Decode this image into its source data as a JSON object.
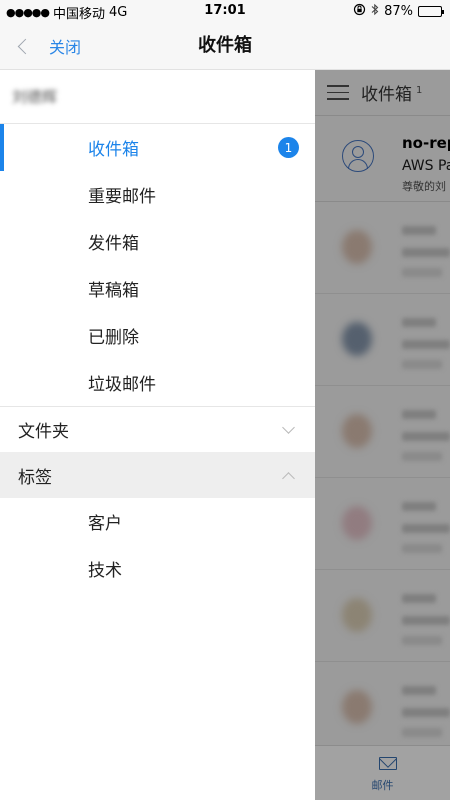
{
  "status_bar": {
    "signal_dots": "●●●●●",
    "carrier": "中国移动",
    "network": "4G",
    "time": "17:01",
    "battery_percent": "87%",
    "battery_level": 0.87,
    "icons": [
      "orientation-lock-icon",
      "bluetooth-icon",
      "battery-icon"
    ]
  },
  "nav": {
    "back_label": "关闭",
    "title": "收件箱"
  },
  "drawer": {
    "account_name": "刘德辉",
    "folders": [
      {
        "label": "收件箱",
        "badge": "1",
        "active": true
      },
      {
        "label": "重要邮件"
      },
      {
        "label": "发件箱"
      },
      {
        "label": "草稿箱"
      },
      {
        "label": "已删除"
      },
      {
        "label": "垃圾邮件"
      }
    ],
    "sections": [
      {
        "label": "文件夹",
        "expanded": false
      },
      {
        "label": "标签",
        "expanded": true
      }
    ],
    "tags": [
      "客户",
      "技术"
    ]
  },
  "background_list": {
    "title": "收件箱",
    "count": "1",
    "first_mail": {
      "sender": "no-rep",
      "subject": "AWS Pa",
      "preview": "尊敬的刘"
    },
    "tab": {
      "label": "邮件",
      "icon": "mail-icon"
    }
  },
  "colors": {
    "accent": "#1c84ea",
    "overlay": "#9b9b9b"
  }
}
